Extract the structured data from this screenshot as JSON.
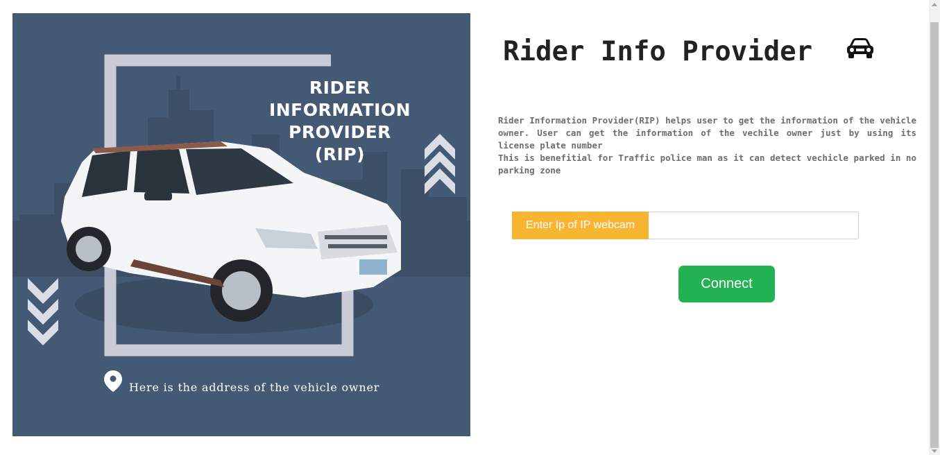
{
  "banner": {
    "title_lines": [
      "RIDER",
      "INFORMATION",
      "PROVIDER",
      "(RIP)"
    ],
    "caption": "Here is the address of the vehicle owner",
    "icons": [
      "location-pin-icon",
      "chevron-up-icon",
      "chevron-down-icon"
    ],
    "colors": {
      "background": "#445a74",
      "frame": "#c9cbd6"
    }
  },
  "header": {
    "title": "Rider Info Provider",
    "icon": "car-icon"
  },
  "description": {
    "line1": "Rider Information Provider(RIP) helps user to get the information of the vehicle owner. User can get the information of the vechile owner just by using its license plate number",
    "line2": "This is benefitial for Traffic police man as it can detect vechicle parked in no parking zone"
  },
  "form": {
    "ip_label": "Enter Ip of IP webcam",
    "ip_value": "",
    "ip_placeholder": "",
    "connect_label": "Connect"
  },
  "colors": {
    "label_bg": "#f8b532",
    "button_bg": "#22b254",
    "text": "#222222",
    "description": "#6d6d6d"
  }
}
